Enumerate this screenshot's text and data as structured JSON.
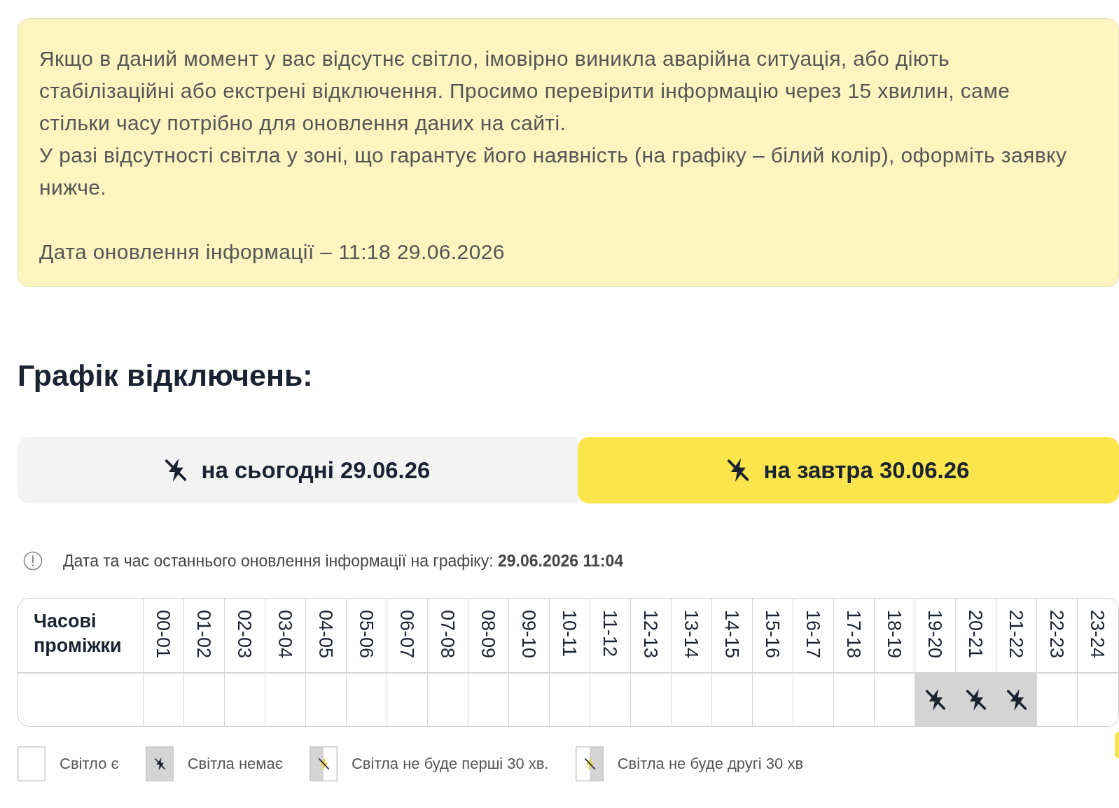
{
  "notice": {
    "paragraphs": [
      "Якщо в даний момент у вас відсутнє світло, імовірно виникла аварійна ситуація, або діють стабілізаційні або екстрені відключення. Просимо перевірити інформацію через 15 хвилин, саме стільки часу потрібно для оновлення даних на сайті.",
      "У разі відсутності світла у зоні, що гарантує його наявність (на графіку – білий колір), оформіть заявку нижче."
    ],
    "update_date": "Дата оновлення інформації – 11:18 29.06.2026"
  },
  "heading": "Графік відключень:",
  "tabs": [
    {
      "label": "на сьогодні 29.06.26",
      "selected": false
    },
    {
      "label": "на завтра 30.06.26",
      "selected": true
    }
  ],
  "schedule_update": "Дата та час останнього оновлення інформації на графіку: **29.06.2026 11:04**",
  "table": {
    "row_header": "Часові проміжки",
    "hours": [
      {
        "label": "00-01",
        "outage": false
      },
      {
        "label": "01-02",
        "outage": false
      },
      {
        "label": "02-03",
        "outage": false
      },
      {
        "label": "03-04",
        "outage": false
      },
      {
        "label": "04-05",
        "outage": false
      },
      {
        "label": "05-06",
        "outage": false
      },
      {
        "label": "06-07",
        "outage": false
      },
      {
        "label": "07-08",
        "outage": false
      },
      {
        "label": "08-09",
        "outage": false
      },
      {
        "label": "09-10",
        "outage": false
      },
      {
        "label": "10-11",
        "outage": false
      },
      {
        "label": "11-12",
        "outage": false
      },
      {
        "label": "12-13",
        "outage": false
      },
      {
        "label": "13-14",
        "outage": false
      },
      {
        "label": "14-15",
        "outage": false
      },
      {
        "label": "15-16",
        "outage": false
      },
      {
        "label": "16-17",
        "outage": false
      },
      {
        "label": "17-18",
        "outage": false
      },
      {
        "label": "18-19",
        "outage": false
      },
      {
        "label": "19-20",
        "outage": true
      },
      {
        "label": "20-21",
        "outage": true
      },
      {
        "label": "21-22",
        "outage": true
      },
      {
        "label": "22-23",
        "outage": false
      },
      {
        "label": "23-24",
        "outage": false
      }
    ]
  },
  "legend": [
    {
      "kind": "on",
      "label": "Світло є"
    },
    {
      "kind": "off",
      "label": "Світла немає"
    },
    {
      "kind": "first_half",
      "label": "Світла не буде перші 30 хв."
    },
    {
      "kind": "second_half",
      "label": "Світла не буде другі 30 хв"
    }
  ]
}
